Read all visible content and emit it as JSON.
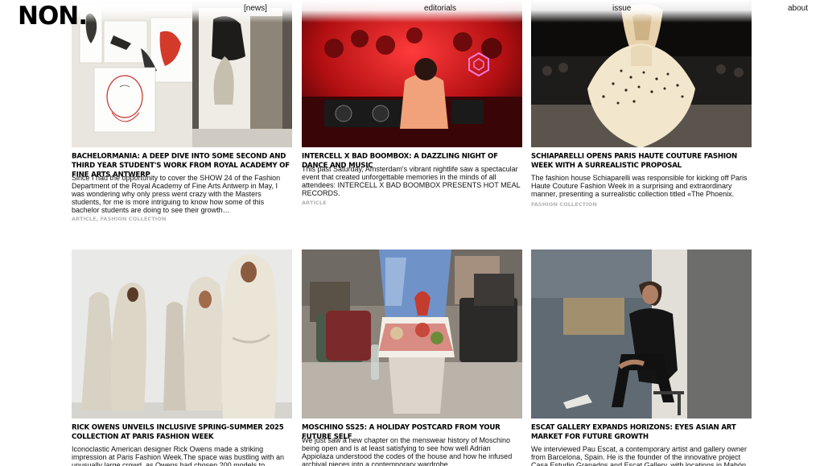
{
  "header": {
    "logo": "NON.",
    "nav": {
      "news": "[news]",
      "editorials": "editorials",
      "issue": "issue",
      "about": "about"
    }
  },
  "articles": [
    {
      "title": "Bachelormania: A Deep Dive Into Some Second And Third Year Student's Work From Royal Academy Of Fine Arts Antwerp",
      "excerpt": "Since I had the opportunity to cover the SHOW 24 of the Fashion Department of the Royal Academy of Fine Arts Antwerp in May, I was wondering why only press went crazy with the Masters students, for me is more intriguing to know how some of this bachelor students are doing to see their growth…",
      "tags": [
        "ARTICLE",
        "FASHION COLLECTION"
      ]
    },
    {
      "title": "Intercell x Bad Boombox: A Dazzling Night Of Dance And Music",
      "excerpt": "This past Saturday, Amsterdam's vibrant nightlife saw a spectacular event that created unforgettable memories in the minds of all attendees: INTERCELL X BAD BOOMBOX PRESENTS HOT MEAL RECORDS.",
      "tags": [
        "ARTICLE"
      ]
    },
    {
      "title": "Schiaparelli Opens Paris Haute Couture Fashion Week With A Surrealistic Proposal",
      "excerpt": "The fashion house Schiaparelli was responsible for kicking off Paris Haute Couture Fashion Week in a surprising and extraordinary manner, presenting a surrealistic collection titled «The Phoenix.",
      "tags": [
        "FASHION COLLECTION"
      ]
    },
    {
      "title": "Rick Owens Unveils Inclusive Spring-Summer 2025 Collection At Paris Fashion Week",
      "excerpt": "Iconoclastic American designer Rick Owens made a striking impression at Paris Fashion Week.The space was bustling with an unusually large crowd, as Owens had chosen 200 models to",
      "tags": []
    },
    {
      "title": "Moschino SS25: A Holiday Postcard From Your Future Self",
      "excerpt": "We just saw a new chapter on the menswear history of Moschino being open and is at least satisfying to see how well Adrian Appiolaza understood the codes of the house and how he infused archival pieces into a contemporary wardrobe.",
      "tags": []
    },
    {
      "title": "Escat Gallery Expands Horizons: Eyes Asian Art Market For Future Growth",
      "excerpt": "We interviewed Pau Escat, a contemporary artist and gallery owner from Barcelona, Spain. He is the founder of the innovative project Casa Estudio Granados and Escat Gallery, with locations in Mahón,",
      "tags": []
    }
  ],
  "tag_separator": ", "
}
